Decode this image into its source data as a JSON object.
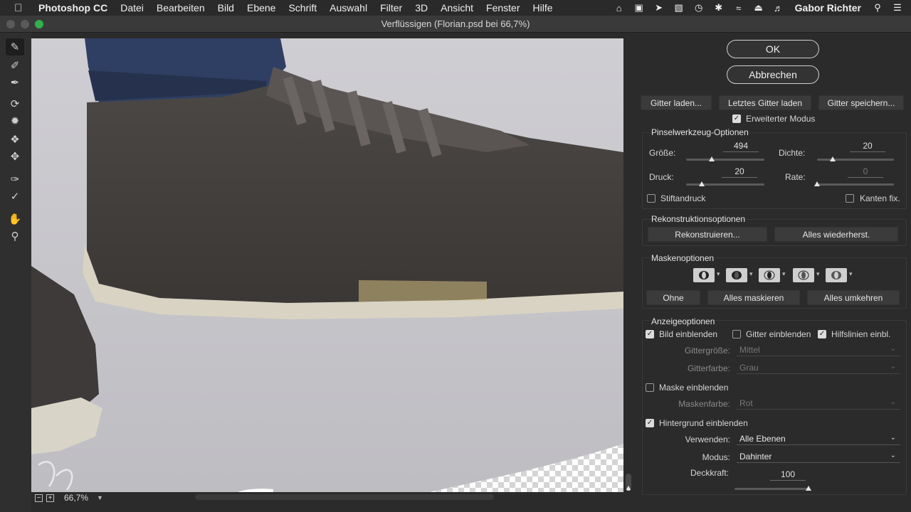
{
  "menubar": {
    "app_name": "Photoshop CC",
    "menus": [
      "Datei",
      "Bearbeiten",
      "Bild",
      "Ebene",
      "Schrift",
      "Auswahl",
      "Filter",
      "3D",
      "Ansicht",
      "Fenster",
      "Hilfe"
    ],
    "user": "Gabor Richter"
  },
  "window": {
    "title": "Verflüssigen (Florian.psd bei 66,7%)"
  },
  "statusbar": {
    "zoom": "66,7%"
  },
  "panel": {
    "ok_label": "OK",
    "cancel_label": "Abbrechen",
    "load_mesh_label": "Gitter laden...",
    "load_last_mesh_label": "Letztes Gitter laden",
    "save_mesh_label": "Gitter speichern...",
    "advanced_mode": {
      "label": "Erweiterter Modus",
      "checked": true
    },
    "brush_options": {
      "title": "Pinselwerkzeug-Optionen",
      "size": {
        "label": "Größe:",
        "value": "494",
        "fraction": 0.33
      },
      "density": {
        "label": "Dichte:",
        "value": "20",
        "fraction": 0.2
      },
      "pressure": {
        "label": "Druck:",
        "value": "20",
        "fraction": 0.2
      },
      "rate": {
        "label": "Rate:",
        "value": "0",
        "fraction": 0.0
      },
      "stylus_pressure": {
        "label": "Stiftandruck",
        "checked": false
      },
      "pin_edges": {
        "label": "Kanten fix.",
        "checked": false
      }
    },
    "reconstruct_options": {
      "title": "Rekonstruktionsoptionen",
      "reconstruct_label": "Rekonstruieren...",
      "restore_all_label": "Alles wiederherst."
    },
    "mask_options": {
      "title": "Maskenoptionen",
      "none_label": "Ohne",
      "mask_all_label": "Alles maskieren",
      "invert_all_label": "Alles umkehren"
    },
    "view_options": {
      "title": "Anzeigeoptionen",
      "show_image": {
        "label": "Bild einblenden",
        "checked": true
      },
      "show_mesh": {
        "label": "Gitter einblenden",
        "checked": false
      },
      "show_guides": {
        "label": "Hilfslinien einbl.",
        "checked": true
      },
      "mesh_size": {
        "label": "Gittergröße:",
        "value": "Mittel"
      },
      "mesh_color": {
        "label": "Gitterfarbe:",
        "value": "Grau"
      },
      "show_mask": {
        "label": "Maske einblenden",
        "checked": false
      },
      "mask_color": {
        "label": "Maskenfarbe:",
        "value": "Rot"
      },
      "show_backdrop": {
        "label": "Hintergrund einblenden",
        "checked": true
      },
      "use": {
        "label": "Verwenden:",
        "value": "Alle Ebenen"
      },
      "mode": {
        "label": "Modus:",
        "value": "Dahinter"
      },
      "opacity": {
        "label": "Deckkraft:",
        "value": "100",
        "fraction": 1.0
      }
    }
  },
  "colors": {
    "panel_bg": "#2b2b2b",
    "canvas_bg": "#c9c8cd",
    "traffic_green": "#2fb24a"
  }
}
